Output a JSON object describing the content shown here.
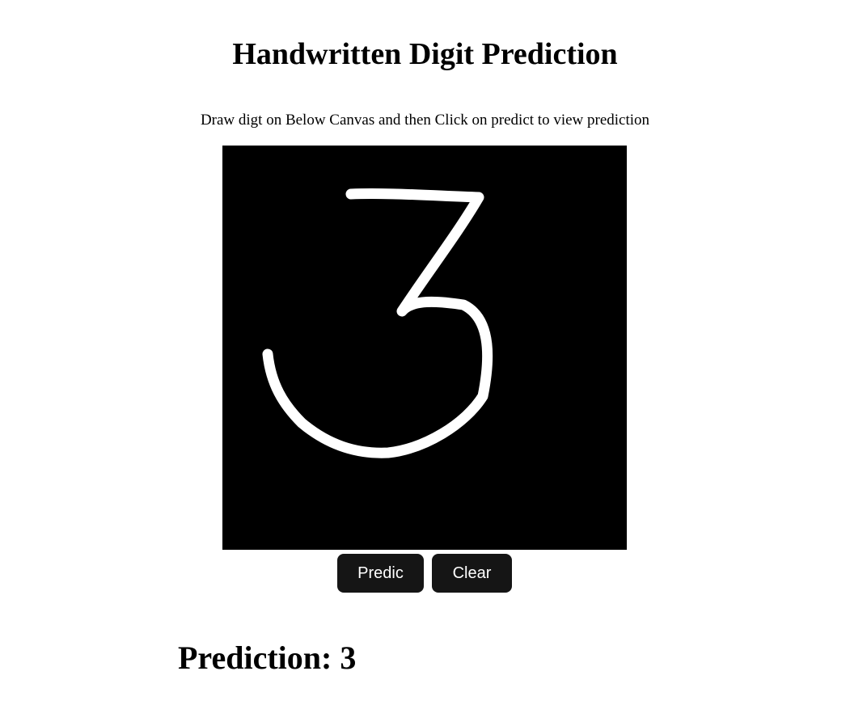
{
  "page": {
    "title": "Handwritten Digit Prediction",
    "instructions": "Draw digt on Below Canvas and then Click on predict to view prediction"
  },
  "canvas": {
    "background_color": "#000000",
    "stroke_color": "#ffffff",
    "drawn_digit": "3"
  },
  "buttons": {
    "predict_label": "Predic",
    "clear_label": "Clear",
    "background_color": "#151515",
    "text_color": "#ffffff"
  },
  "result": {
    "label": "Prediction:",
    "value": "3"
  }
}
